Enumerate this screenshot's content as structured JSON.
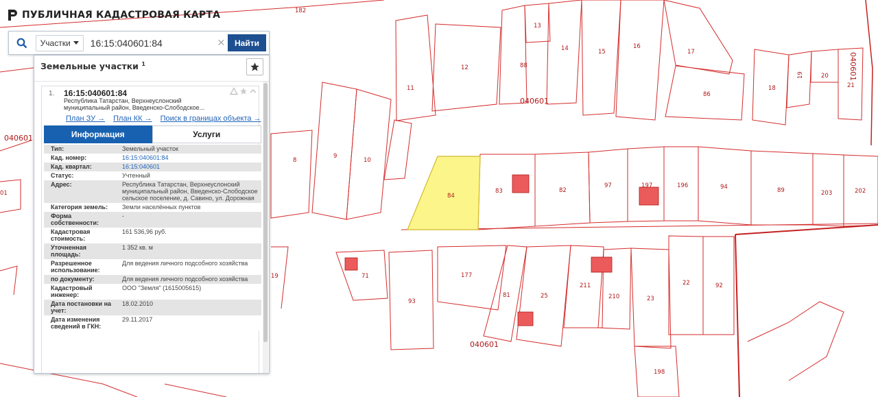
{
  "app": {
    "title": "ПУБЛИЧНАЯ КАДАСТРОВАЯ КАРТА"
  },
  "search": {
    "type_label": "Участки",
    "query": "16:15:040601:84",
    "find_label": "Найти"
  },
  "panel": {
    "heading": "Земельные участки",
    "heading_count": "1"
  },
  "result": {
    "number": "1.",
    "code": "16:15:040601:84",
    "address_short": "Республика Татарстан, Верхнеуслонский муниципальный район, Введенско-Слободское...",
    "links": {
      "plan_zu": "План ЗУ →",
      "plan_kk": "План КК →",
      "search_bounds": "Поиск в границах объекта →"
    },
    "tabs": {
      "info": "Информация",
      "services": "Услуги"
    },
    "attributes": [
      {
        "key": "Тип:",
        "value": "Земельный участок"
      },
      {
        "key": "Кад. номер:",
        "value": "16:15:040601:84"
      },
      {
        "key": "Кад. квартал:",
        "value": "16:15:040601"
      },
      {
        "key": "Статус:",
        "value": "Учтенный"
      },
      {
        "key": "Адрес:",
        "value": "Республика Татарстан, Верхнеуслонский муниципальный район, Введенско-Слободское сельское поселение, д. Савино, ул. Дорожная"
      },
      {
        "key": "Категория земель:",
        "value": "Земли населённых пунктов"
      },
      {
        "key": "Форма собственности:",
        "value": "-"
      },
      {
        "key": "Кадастровая стоимость:",
        "value": "161 536,96 руб."
      },
      {
        "key": "Уточненная площадь:",
        "value": "1 352 кв. м"
      },
      {
        "key": "Разрешенное использование:",
        "value": "Для ведения личного подсобного хозяйства"
      },
      {
        "key": "по документу:",
        "value": "Для ведения личного подсобного хозяйства"
      },
      {
        "key": "Кадастровый инженер:",
        "value": "ООО \"Земля\" (1615005615)"
      },
      {
        "key": "Дата постановки на учет:",
        "value": "18.02.2010"
      },
      {
        "key": "Дата изменения сведений в ГКН:",
        "value": "29.11.2017"
      }
    ]
  },
  "map": {
    "quarter_labels": [
      "040601",
      "040601",
      "040601",
      "040601"
    ],
    "parcel_labels": [
      "182",
      "13",
      "88",
      "14",
      "15",
      "16",
      "17",
      "12",
      "11",
      "86",
      "18",
      "19",
      "20",
      "21",
      "8",
      "9",
      "10",
      "84",
      "83",
      "82",
      "97",
      "197",
      "196",
      "94",
      "89",
      "203",
      "202",
      "71",
      "93",
      "177",
      "81",
      "25",
      "211",
      "210",
      "23",
      "22",
      "92",
      "198",
      "01",
      "19"
    ],
    "colors": {
      "parcel_line": "#d42a2a",
      "selected_fill": "#fbf58a",
      "selected_stroke": "#d4b82a",
      "building_fill": "#ec5b5b"
    }
  }
}
